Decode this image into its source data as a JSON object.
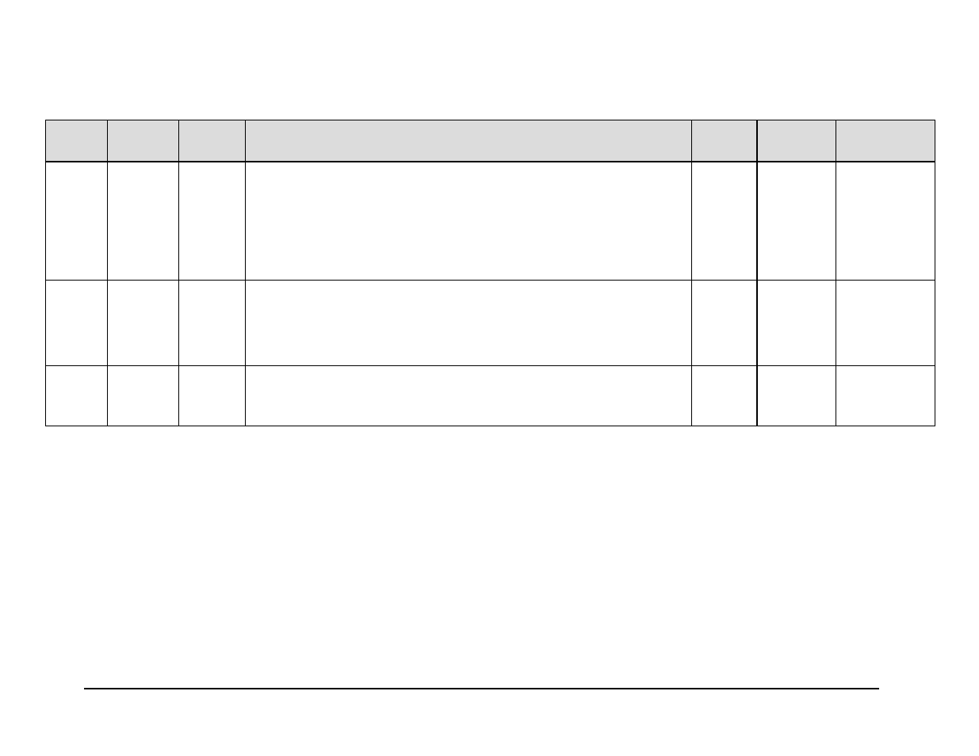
{
  "table": {
    "headers": [
      "",
      "",
      "",
      "",
      "",
      "",
      ""
    ],
    "rows": [
      [
        "",
        "",
        "",
        "",
        "",
        "",
        ""
      ],
      [
        "",
        "",
        "",
        "",
        "",
        "",
        ""
      ],
      [
        "",
        "",
        "",
        "",
        "",
        "",
        ""
      ]
    ]
  }
}
